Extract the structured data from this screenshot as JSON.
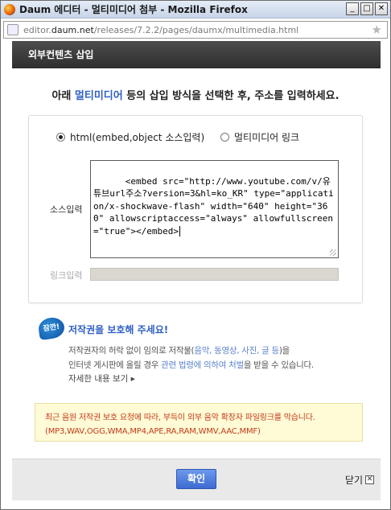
{
  "window": {
    "title": "Daum 에디터 - 멀티미디어 첨부 - Mozilla Firefox",
    "controls": {
      "minimize": "_",
      "maximize": "□",
      "close": "✕"
    }
  },
  "address": {
    "prefix": "editor.",
    "host": "daum.net",
    "path": "/releases/7.2.2/pages/daumx/multimedia.html"
  },
  "dialog": {
    "header": "외부컨텐츠 삽입",
    "instruction_pre": "아래 ",
    "instruction_highlight": "멀티미디어",
    "instruction_post": " 등의 삽입 방식을 선택한 후, 주소를 입력하세요.",
    "options": [
      {
        "label": "html(embed,object 소스입력)",
        "selected": true
      },
      {
        "label": "멀티미디어 링크",
        "selected": false
      }
    ],
    "source_label": "소스입력",
    "source_value": "<embed src=\"http://www.youtube.com/v/유튜브url주소?version=3&hl=ko_KR\" type=\"application/x-shockwave-flash\" width=\"640\" height=\"360\" allowscriptaccess=\"always\" allowfullscreen=\"true\"></embed>",
    "link_label": "링크입력",
    "link_value": ""
  },
  "copyright": {
    "badge": "잠깐!",
    "title": "저작권을 보호해 주세요!",
    "line1_a": "저작권자의 허락 없이 임의로 저작물(",
    "line1_link": "음악, 동영상, 사진, 글 등",
    "line1_b": ")을",
    "line2_a": "인터넷 게시판에 올릴 경우 ",
    "line2_link": "관련 법령에 의하여 처벌",
    "line2_b": "을 받을 수 있습니다.",
    "more": "자세한 내용 보기 ▸"
  },
  "warning": {
    "line1": "최근 음원 저작권 보호 요청에 따라, 부득이 외부 음악 확장자 파일링크를 막습니다.",
    "line2": "(MP3,WAV,OGG,WMA,MP4,APE,RA,RAM,WMV,AAC,MMF)"
  },
  "footer": {
    "confirm": "확인",
    "close": "닫기",
    "close_glyph": "✕"
  },
  "colors": {
    "accent": "#2f5fc4",
    "header_bg": "#3a3a3a",
    "warning_text": "#c43a1b",
    "warning_bg": "#fefbd6",
    "confirm_bg": "#4f7fe0"
  }
}
